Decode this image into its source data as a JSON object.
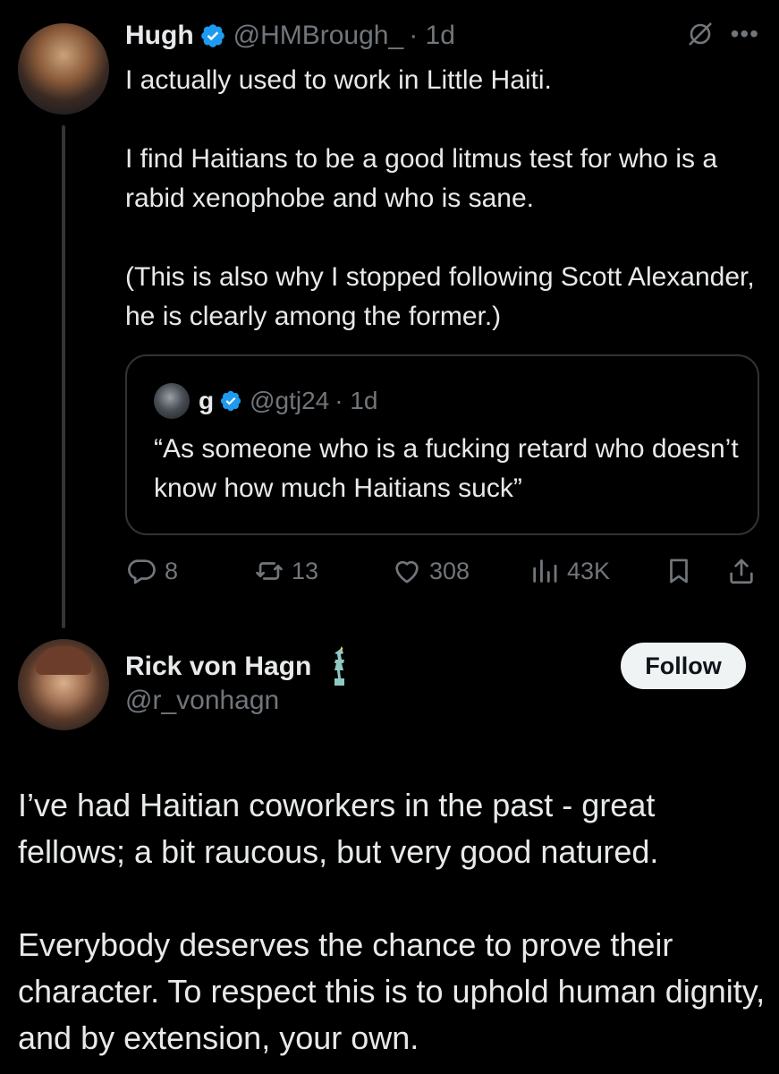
{
  "post": {
    "author": {
      "name": "Hugh",
      "handle": "@HMBrough_",
      "time": "· 1d",
      "verified": true
    },
    "paragraphs": [
      "I actually used to work in Little Haiti.",
      "I find Haitians to be a good litmus test for who is a rabid xenophobe and who is sane.",
      "(This is also why I stopped following Scott Alexander, he is clearly among the former.)"
    ],
    "quote": {
      "name": "g",
      "handle": "@gtj24",
      "time": "· 1d",
      "text": "“As someone who is a fucking retard who doesn’t know how much Haitians suck”"
    },
    "actions": {
      "replies": "8",
      "reposts": "13",
      "likes": "308",
      "views": "43K"
    },
    "icons": [
      "grok-icon",
      "more-icon",
      "reply-icon",
      "repost-icon",
      "like-icon",
      "views-icon",
      "bookmark-icon",
      "share-icon"
    ]
  },
  "reply": {
    "author": {
      "name": "Rick von Hagn",
      "handle": "@r_vonhagn",
      "badge": "statue-of-liberty-icon"
    },
    "follow_label": "Follow",
    "paragraphs": [
      "I’ve had Haitian coworkers in the past - great fellows; a bit raucous, but very good natured.",
      "Everybody deserves the chance to prove their character. To respect this is to uphold human dignity, and by extension, your own."
    ]
  },
  "colors": {
    "background": "#000000",
    "text": "#e7e9ea",
    "muted": "#71767b",
    "verified": "#1d9bf0",
    "border": "#2f3336",
    "follow_bg": "#eff3f4"
  }
}
